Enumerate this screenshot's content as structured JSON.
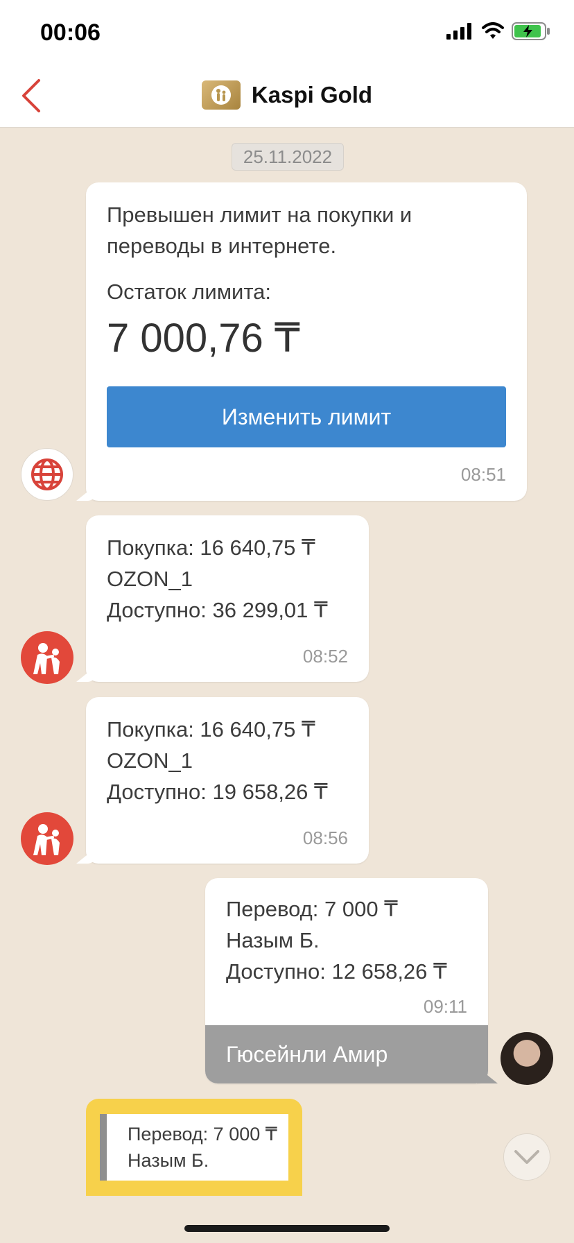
{
  "status_bar": {
    "time": "00:06"
  },
  "nav": {
    "title": "Kaspi Gold"
  },
  "date_separator": "25.11.2022",
  "messages": [
    {
      "text_line1": "Превышен лимит на покупки и",
      "text_line2": "переводы в интернете.",
      "remain_label": "Остаток лимита:",
      "amount": "7 000,76 ₸",
      "button_label": "Изменить лимит",
      "time": "08:51"
    },
    {
      "line1": "Покупка: 16 640,75 ₸",
      "line2": "OZON_1",
      "line3": "Доступно: 36 299,01 ₸",
      "time": "08:52"
    },
    {
      "line1": "Покупка: 16 640,75 ₸",
      "line2": "OZON_1",
      "line3": "Доступно: 19 658,26 ₸",
      "time": "08:56"
    },
    {
      "line1": "Перевод: 7 000 ₸",
      "line2": "Назым Б.",
      "line3": "Доступно: 12 658,26 ₸",
      "time": "09:11",
      "sender": "Гюсейнли Амир"
    },
    {
      "line1": "Перевод: 7 000 ₸",
      "line2": "Назым Б."
    }
  ],
  "icons": {
    "back": "chevron-left-icon",
    "globe": "globe-icon",
    "kaspi": "kaspi-family-icon",
    "scroll_down": "chevron-down-icon"
  },
  "colors": {
    "accent_red": "#e2483a",
    "button_blue": "#3d87cf",
    "chat_bg": "#efe5d8",
    "highlight_yellow": "#f7d14b"
  }
}
